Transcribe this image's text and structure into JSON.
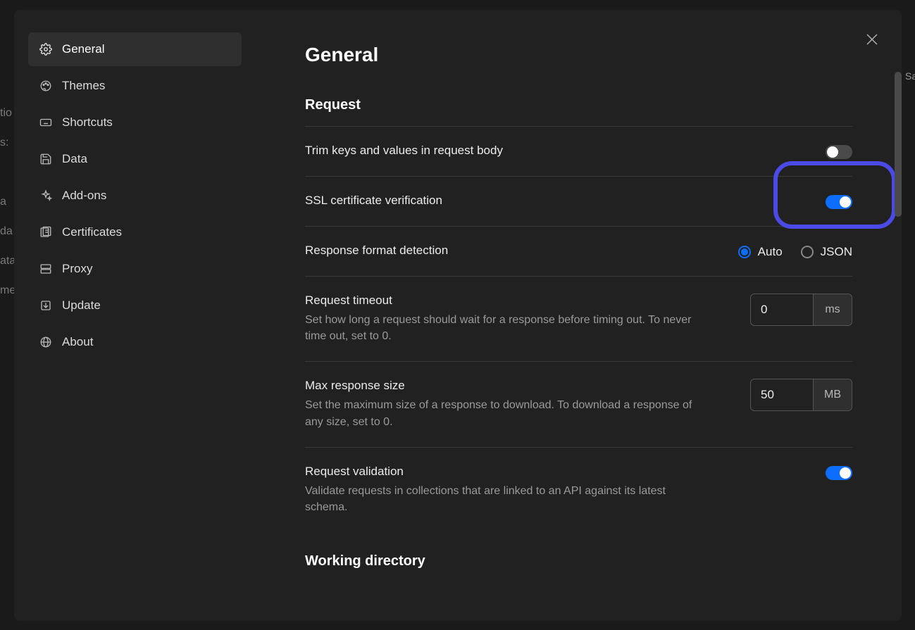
{
  "sidebar": {
    "items": [
      {
        "id": "general",
        "label": "General",
        "icon": "gear"
      },
      {
        "id": "themes",
        "label": "Themes",
        "icon": "palette"
      },
      {
        "id": "shortcuts",
        "label": "Shortcuts",
        "icon": "keyboard"
      },
      {
        "id": "data",
        "label": "Data",
        "icon": "save"
      },
      {
        "id": "addons",
        "label": "Add-ons",
        "icon": "sparkle"
      },
      {
        "id": "certificates",
        "label": "Certificates",
        "icon": "certificate"
      },
      {
        "id": "proxy",
        "label": "Proxy",
        "icon": "server"
      },
      {
        "id": "update",
        "label": "Update",
        "icon": "download"
      },
      {
        "id": "about",
        "label": "About",
        "icon": "globe"
      }
    ],
    "active": "general"
  },
  "page": {
    "title": "General",
    "sections": {
      "request": {
        "heading": "Request",
        "trim_keys": {
          "label": "Trim keys and values in request body",
          "value": false
        },
        "ssl_verification": {
          "label": "SSL certificate verification",
          "value": true,
          "highlighted": true
        },
        "response_format": {
          "label": "Response format detection",
          "options": [
            "Auto",
            "JSON"
          ],
          "selected": "Auto"
        },
        "request_timeout": {
          "label": "Request timeout",
          "desc": "Set how long a request should wait for a response before timing out. To never time out, set to 0.",
          "value": "0",
          "unit": "ms"
        },
        "max_response_size": {
          "label": "Max response size",
          "desc": "Set the maximum size of a response to download. To download a response of any size, set to 0.",
          "value": "50",
          "unit": "MB"
        },
        "request_validation": {
          "label": "Request validation",
          "desc": "Validate requests in collections that are linked to an API against its latest schema.",
          "value": true
        }
      },
      "working_directory": {
        "heading": "Working directory"
      }
    }
  }
}
